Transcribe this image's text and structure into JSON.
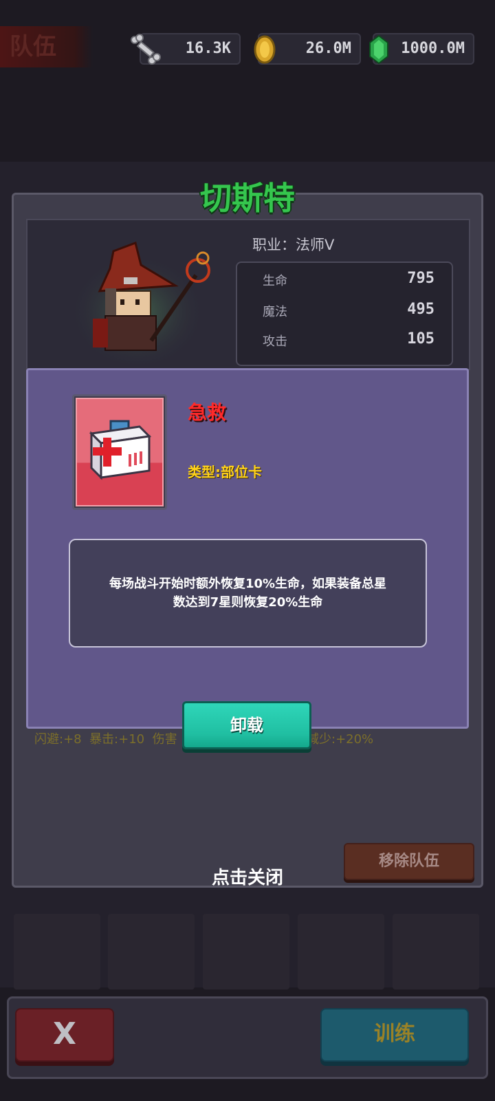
{
  "header": {
    "team_label": "队伍",
    "resources": [
      {
        "icon": "bone-icon",
        "value": "16.3K"
      },
      {
        "icon": "gold-coin-icon",
        "value": "26.0M"
      },
      {
        "icon": "green-gem-icon",
        "value": "1000.0M"
      }
    ]
  },
  "character": {
    "name": "切斯特",
    "class_text": "职业：法师Ⅴ",
    "stats": [
      {
        "label": "生命",
        "value": "795"
      },
      {
        "label": "魔法",
        "value": "495"
      },
      {
        "label": "攻击",
        "value": "105"
      }
    ],
    "bonus_parts": [
      "闪避:+8",
      "暴击:+10",
      "伤害",
      "减少:+20%"
    ],
    "remove_button": "移除队伍",
    "close_hint": "点击关闭"
  },
  "popup": {
    "skill_name": "急救",
    "skill_type": "类型:部位卡",
    "description_line1": "每场战斗开始时额外恢复10%生命，如果装备总星",
    "description_line2": "数达到7星则恢复20%生命",
    "unequip_button": "卸载",
    "colors": {
      "name": "#ff2a2a",
      "type": "#ffd21a",
      "panel": "#61578a"
    }
  },
  "footer": {
    "close_button": "X",
    "train_button": "训练"
  }
}
